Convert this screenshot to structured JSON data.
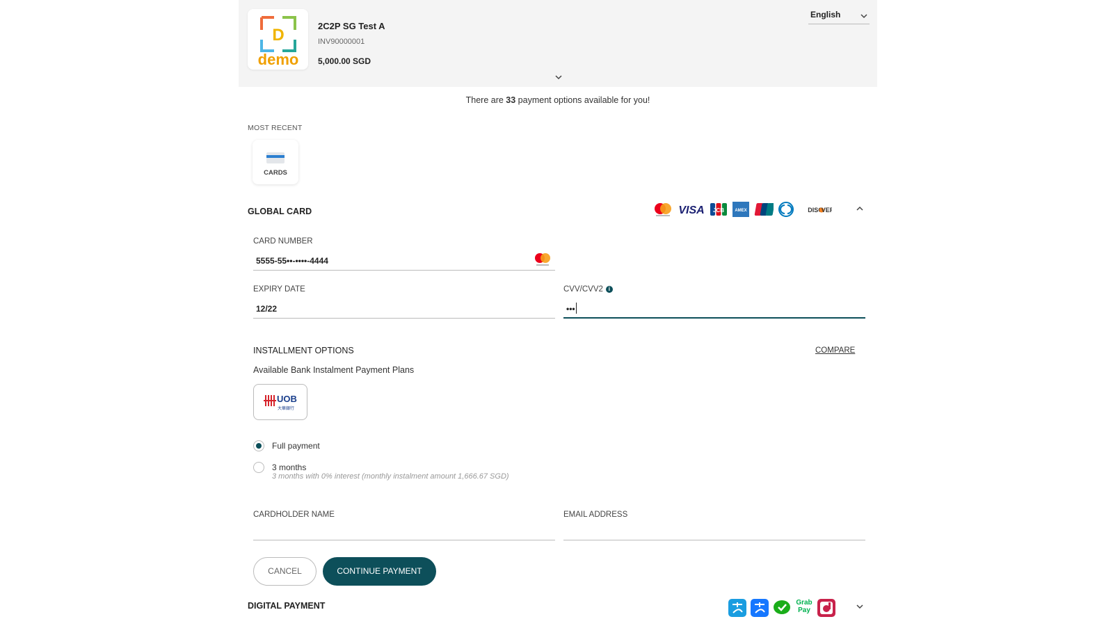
{
  "header": {
    "logo_text": "demo",
    "logo_letter": "D",
    "merchant_name": "2C2P SG Test A",
    "invoice_no": "INV90000001",
    "amount": "5,000.00 SGD",
    "language": "English"
  },
  "options": {
    "prefix": "There are ",
    "count": "33",
    "suffix": " payment options available for you!"
  },
  "most_recent": {
    "label": "MOST RECENT",
    "tile_label": "CARDS"
  },
  "global_card": {
    "title": "GLOBAL CARD",
    "brands": [
      "mastercard",
      "VISA",
      "JCB",
      "AMEX",
      "UnionPay",
      "Diners",
      "DISCOVER"
    ],
    "card_number_label": "CARD NUMBER",
    "card_number_value": "5555-55••-••••-4444",
    "expiry_label": "EXPIRY DATE",
    "expiry_value": "12/22",
    "cvv_label": "CVV/CVV2",
    "cvv_value": "•••",
    "cvv_info": "i",
    "installment_title": "INSTALLMENT OPTIONS",
    "compare_label": "COMPARE",
    "installment_subtitle": "Available Bank Instalment Payment Plans",
    "bank_name": "UOB",
    "bank_subtext": "大華銀行",
    "plans": [
      {
        "label": "Full payment",
        "note": "",
        "selected": true
      },
      {
        "label": "3 months",
        "note": "3 months with 0% interest (monthly instalment amount 1,666.67 SGD)",
        "selected": false
      }
    ],
    "cardholder_label": "CARDHOLDER NAME",
    "cardholder_value": "",
    "email_label": "EMAIL ADDRESS",
    "email_value": "",
    "cancel_label": "CANCEL",
    "continue_label": "CONTINUE PAYMENT"
  },
  "digital_payment": {
    "title": "DIGITAL PAYMENT",
    "icons": [
      "alipay-hk-icon",
      "alipay-icon",
      "wechat-pay-icon",
      "grab-pay-icon",
      "dash-icon"
    ],
    "grab_label": "Grab Pay"
  },
  "colors": {
    "accent": "#0d4f5a",
    "header_bg": "#f4f4f4"
  }
}
